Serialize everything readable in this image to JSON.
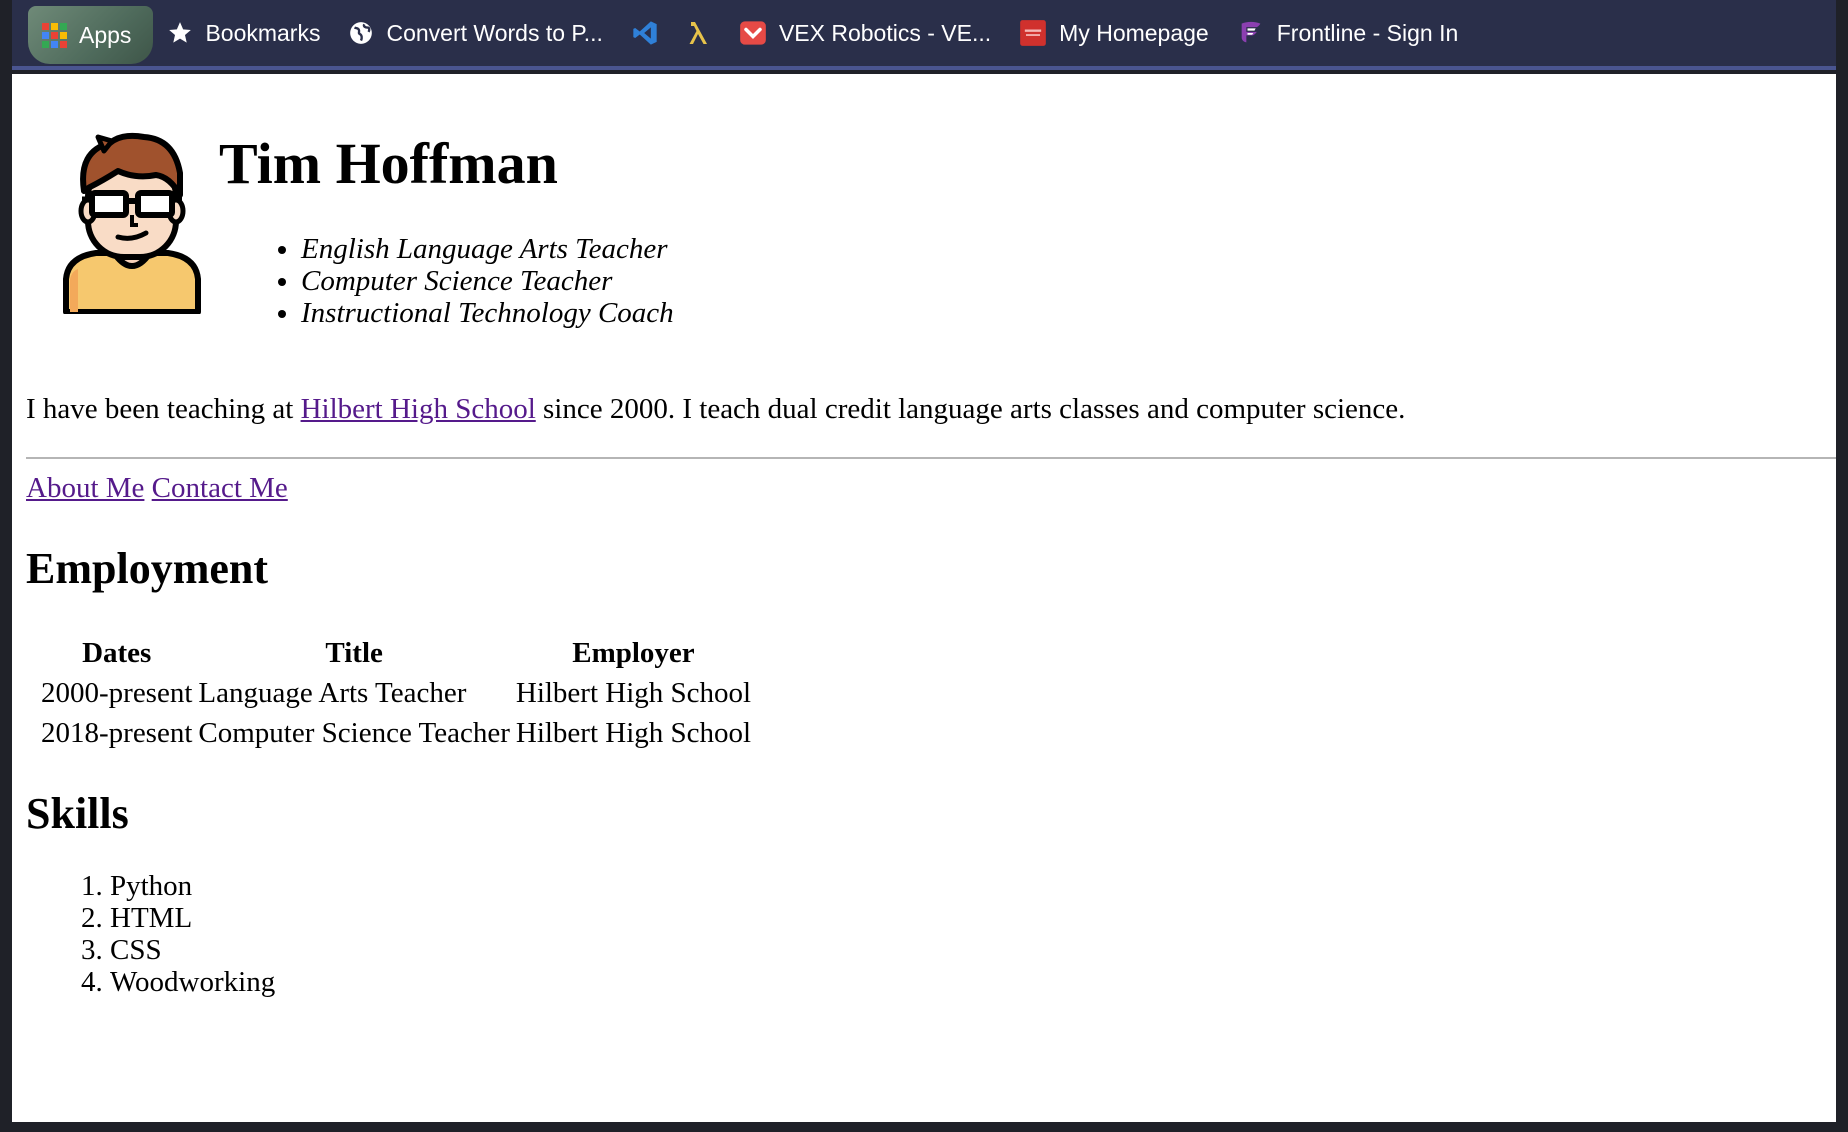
{
  "bookmarks_bar": {
    "apps": "Apps",
    "items": [
      {
        "label": "Bookmarks",
        "icon": "star-icon"
      },
      {
        "label": "Convert Words to P...",
        "icon": "globe-icon"
      },
      {
        "label": "",
        "icon": "vscode-icon"
      },
      {
        "label": "",
        "icon": "lambda-icon"
      },
      {
        "label": "VEX Robotics - VE...",
        "icon": "pocket-icon"
      },
      {
        "label": "My Homepage",
        "icon": "oracle-icon"
      },
      {
        "label": "Frontline - Sign In",
        "icon": "frontline-icon"
      }
    ]
  },
  "header": {
    "name": "Tim Hoffman",
    "roles": [
      "English Language Arts Teacher",
      "Computer Science Teacher",
      "Instructional Technology Coach"
    ]
  },
  "intro": {
    "before": "I have been teaching at ",
    "link": "Hilbert High School",
    "after": " since 2000. I teach dual credit language arts classes and computer science."
  },
  "nav": {
    "about": "About Me",
    "contact": "Contact Me"
  },
  "employment": {
    "heading": "Employment",
    "columns": [
      "Dates",
      "Title",
      "Employer"
    ],
    "rows": [
      [
        "2000-present",
        "Language Arts Teacher",
        "Hilbert High School"
      ],
      [
        "2018-present",
        "Computer Science Teacher",
        "Hilbert High School"
      ]
    ]
  },
  "skills": {
    "heading": "Skills",
    "items": [
      "Python",
      "HTML",
      "CSS",
      "Woodworking"
    ]
  },
  "colors": {
    "bar_bg": "#2a2f4a",
    "link": "#551a8b",
    "pocket_red": "#e64a46",
    "oracle_red": "#d0312d",
    "vscode_blue": "#2f80d8",
    "lambda_yellow": "#e7c34a",
    "frontline_purple": "#8b3fb0"
  }
}
